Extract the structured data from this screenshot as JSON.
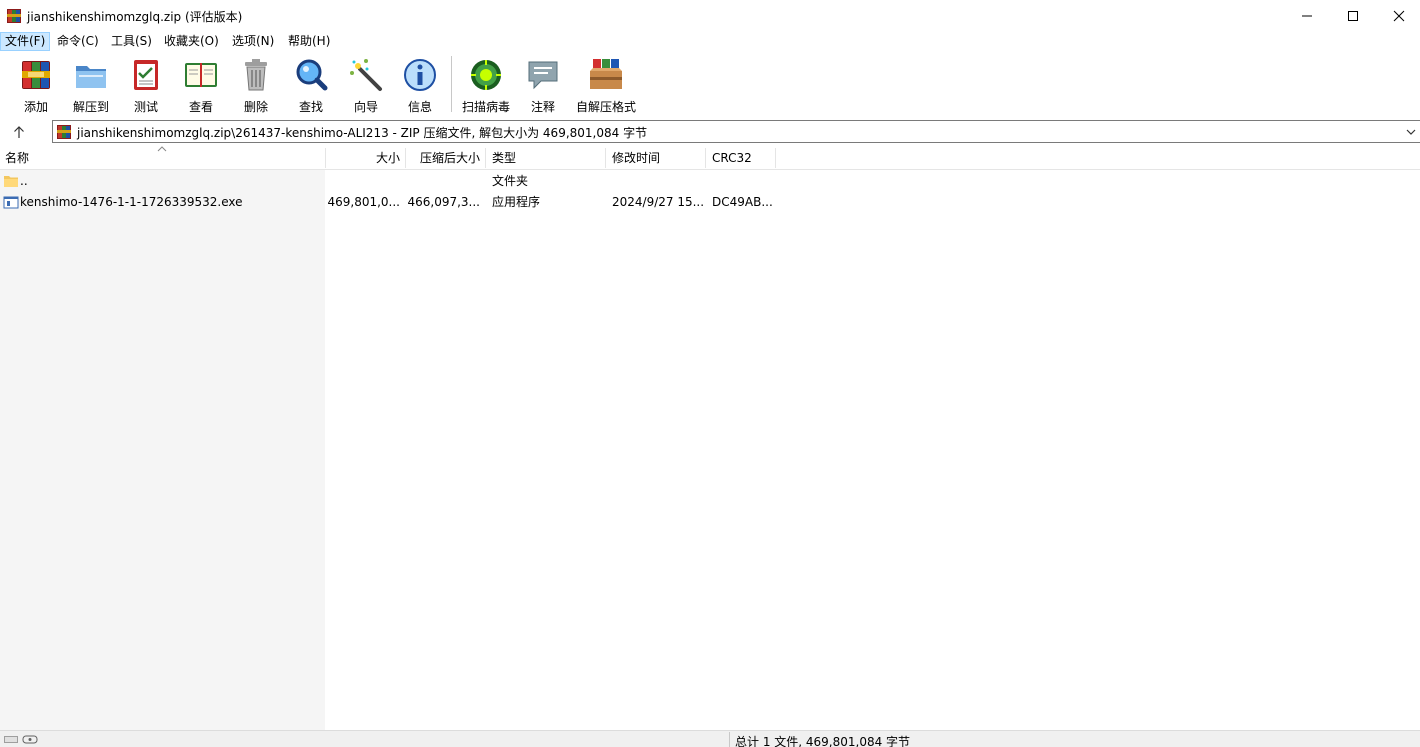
{
  "window": {
    "title": "jianshikenshimomzglq.zip (评估版本)",
    "icon": "winrar-icon"
  },
  "menu": [
    {
      "label": "文件(F)",
      "active": true
    },
    {
      "label": "命令(C)"
    },
    {
      "label": "工具(S)"
    },
    {
      "label": "收藏夹(O)"
    },
    {
      "label": "选项(N)"
    },
    {
      "label": "帮助(H)"
    }
  ],
  "toolbar": [
    {
      "label": "添加",
      "icon": "add-archive-icon"
    },
    {
      "label": "解压到",
      "icon": "extract-to-icon"
    },
    {
      "label": "测试",
      "icon": "test-icon"
    },
    {
      "label": "查看",
      "icon": "view-book-icon"
    },
    {
      "label": "删除",
      "icon": "trash-icon"
    },
    {
      "label": "查找",
      "icon": "magnifier-icon"
    },
    {
      "label": "向导",
      "icon": "wizard-wand-icon"
    },
    {
      "label": "信息",
      "icon": "info-icon"
    },
    {
      "label": "扫描病毒",
      "icon": "virus-scan-icon"
    },
    {
      "label": "注释",
      "icon": "comment-icon"
    },
    {
      "label": "自解压格式",
      "icon": "sfx-box-icon"
    }
  ],
  "address": {
    "path": "jianshikenshimomzglq.zip\\261437-kenshimo-ALI213 - ZIP 压缩文件, 解包大小为 469,801,084 字节"
  },
  "columns": {
    "name": "名称",
    "size": "大小",
    "packed": "压缩后大小",
    "type": "类型",
    "modified": "修改时间",
    "crc": "CRC32"
  },
  "rows": [
    {
      "name": "..",
      "size": "",
      "packed": "",
      "type": "文件夹",
      "modified": "",
      "crc": "",
      "icon": "folder-icon"
    },
    {
      "name": "kenshimo-1476-1-1-1726339532.exe",
      "size": "469,801,0...",
      "packed": "466,097,3...",
      "type": "应用程序",
      "modified": "2024/9/27 15...",
      "crc": "DC49AB...",
      "icon": "exe-file-icon"
    }
  ],
  "status": {
    "total": "总计 1 文件, 469,801,084 字节"
  },
  "colors": {
    "menu_active_bg": "#cce8ff",
    "left_pane_bg": "#f5f5f5",
    "statusbar_bg": "#f0f0f0"
  }
}
